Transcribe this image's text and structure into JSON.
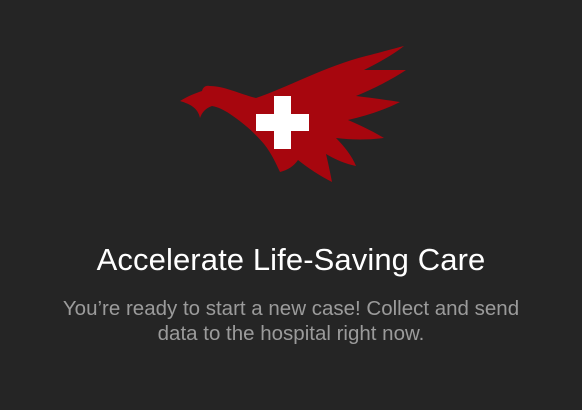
{
  "brand": {
    "logo_icon": "eagle-medical-cross-icon",
    "logo_color": "#A7060E",
    "cross_color": "#FFFFFF"
  },
  "empty_state": {
    "title": "Accelerate Life-Saving Care",
    "message": "You’re ready to start a new case! Collect and send data to the hospital right now."
  },
  "colors": {
    "background": "#252525",
    "title": "#FFFFFF",
    "message": "#9B9B9B"
  }
}
